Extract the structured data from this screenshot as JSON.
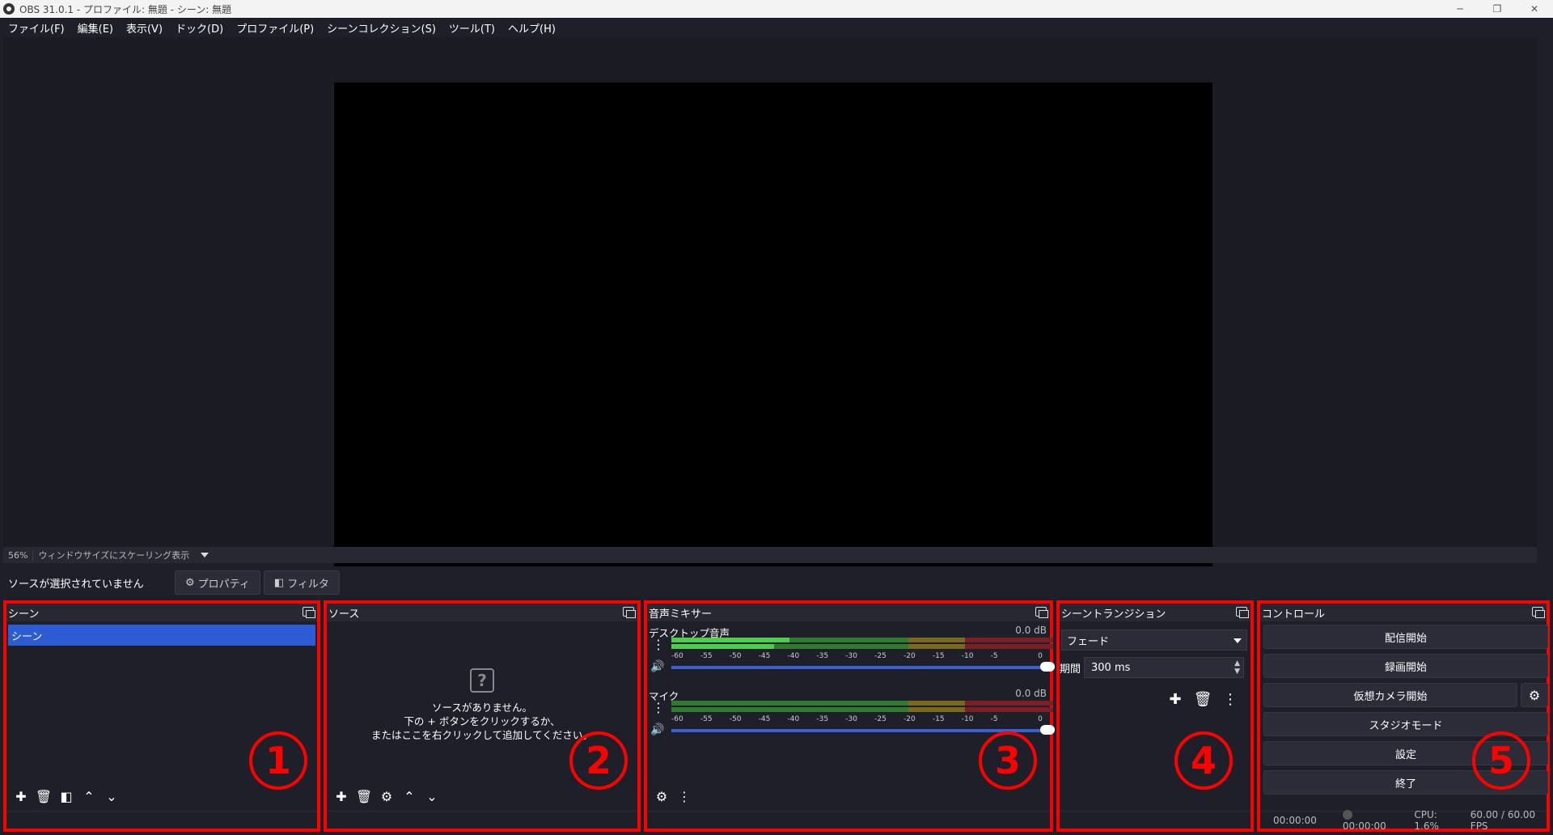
{
  "window": {
    "title": "OBS 31.0.1 - プロファイル: 無題 - シーン: 無題",
    "minimize": "─",
    "restore": "❐",
    "close": "✕"
  },
  "menu": [
    "ファイル(F)",
    "編集(E)",
    "表示(V)",
    "ドック(D)",
    "プロファイル(P)",
    "シーンコレクション(S)",
    "ツール(T)",
    "ヘルプ(H)"
  ],
  "zoombar": {
    "zoom": "56%",
    "mode": "ウィンドウサイズにスケーリング表示"
  },
  "source_bar": {
    "label": "ソースが選択されていません",
    "properties": "プロパティ",
    "filters": "フィルタ"
  },
  "scenes": {
    "title": "シーン",
    "items": [
      "シーン"
    ]
  },
  "sources": {
    "title": "ソース",
    "empty_line1": "ソースがありません。",
    "empty_line2": "下の + ボタンをクリックするか、",
    "empty_line3": "またはここを右クリックして追加してください。"
  },
  "mixer": {
    "title": "音声ミキサー",
    "channels": [
      {
        "name": "デスクトップ音声",
        "db": "0.0 dB"
      },
      {
        "name": "マイク",
        "db": "0.0 dB"
      }
    ],
    "ticks": [
      "-60",
      "-55",
      "-50",
      "-45",
      "-40",
      "-35",
      "-30",
      "-25",
      "-20",
      "-15",
      "-10",
      "-5",
      "0"
    ]
  },
  "transitions": {
    "title": "シーントランジション",
    "selected": "フェード",
    "duration_label": "期間",
    "duration": "300 ms"
  },
  "controls": {
    "title": "コントロール",
    "buttons": [
      "配信開始",
      "録画開始",
      "仮想カメラ開始",
      "スタジオモード",
      "設定",
      "終了"
    ],
    "status": {
      "stream_time": "00:00:00",
      "rec_time": "00:00:00",
      "cpu": "CPU: 1.6%",
      "fps": "60.00 / 60.00 FPS"
    }
  },
  "annotations": [
    "1",
    "2",
    "3",
    "4",
    "5"
  ],
  "colors": {
    "annotation": "#ff0000",
    "selection": "#2d5bd4"
  }
}
